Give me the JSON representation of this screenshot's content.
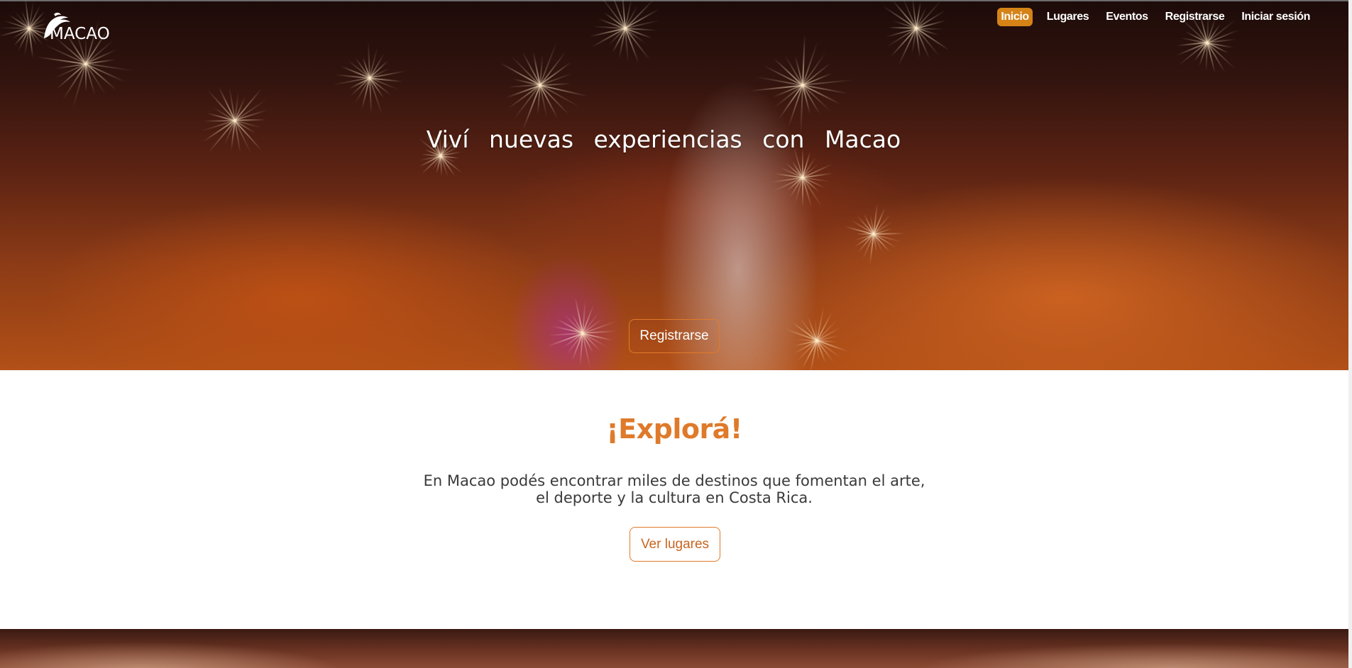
{
  "brand": {
    "logo_text": "MACAO",
    "icon": "macaw-logo-icon"
  },
  "nav": {
    "items": [
      {
        "label": "Inicio",
        "active": true
      },
      {
        "label": "Lugares",
        "active": false
      },
      {
        "label": "Eventos",
        "active": false
      },
      {
        "label": "Registrarse",
        "active": false
      },
      {
        "label": "Iniciar sesión",
        "active": false
      }
    ]
  },
  "hero": {
    "title": "Viví nuevas experiencias con Macao",
    "button_label": "Registrarse"
  },
  "explore": {
    "title": "¡Explorá!",
    "text_line1": "En Macao podés encontrar miles de destinos que fomentan el arte,",
    "text_line2": "el deporte y la cultura en Costa Rica.",
    "button_label": "Ver lugares"
  },
  "colors": {
    "accent": "#df7a2a",
    "nav_active": "#d58317",
    "text": "#3a3a3a"
  }
}
